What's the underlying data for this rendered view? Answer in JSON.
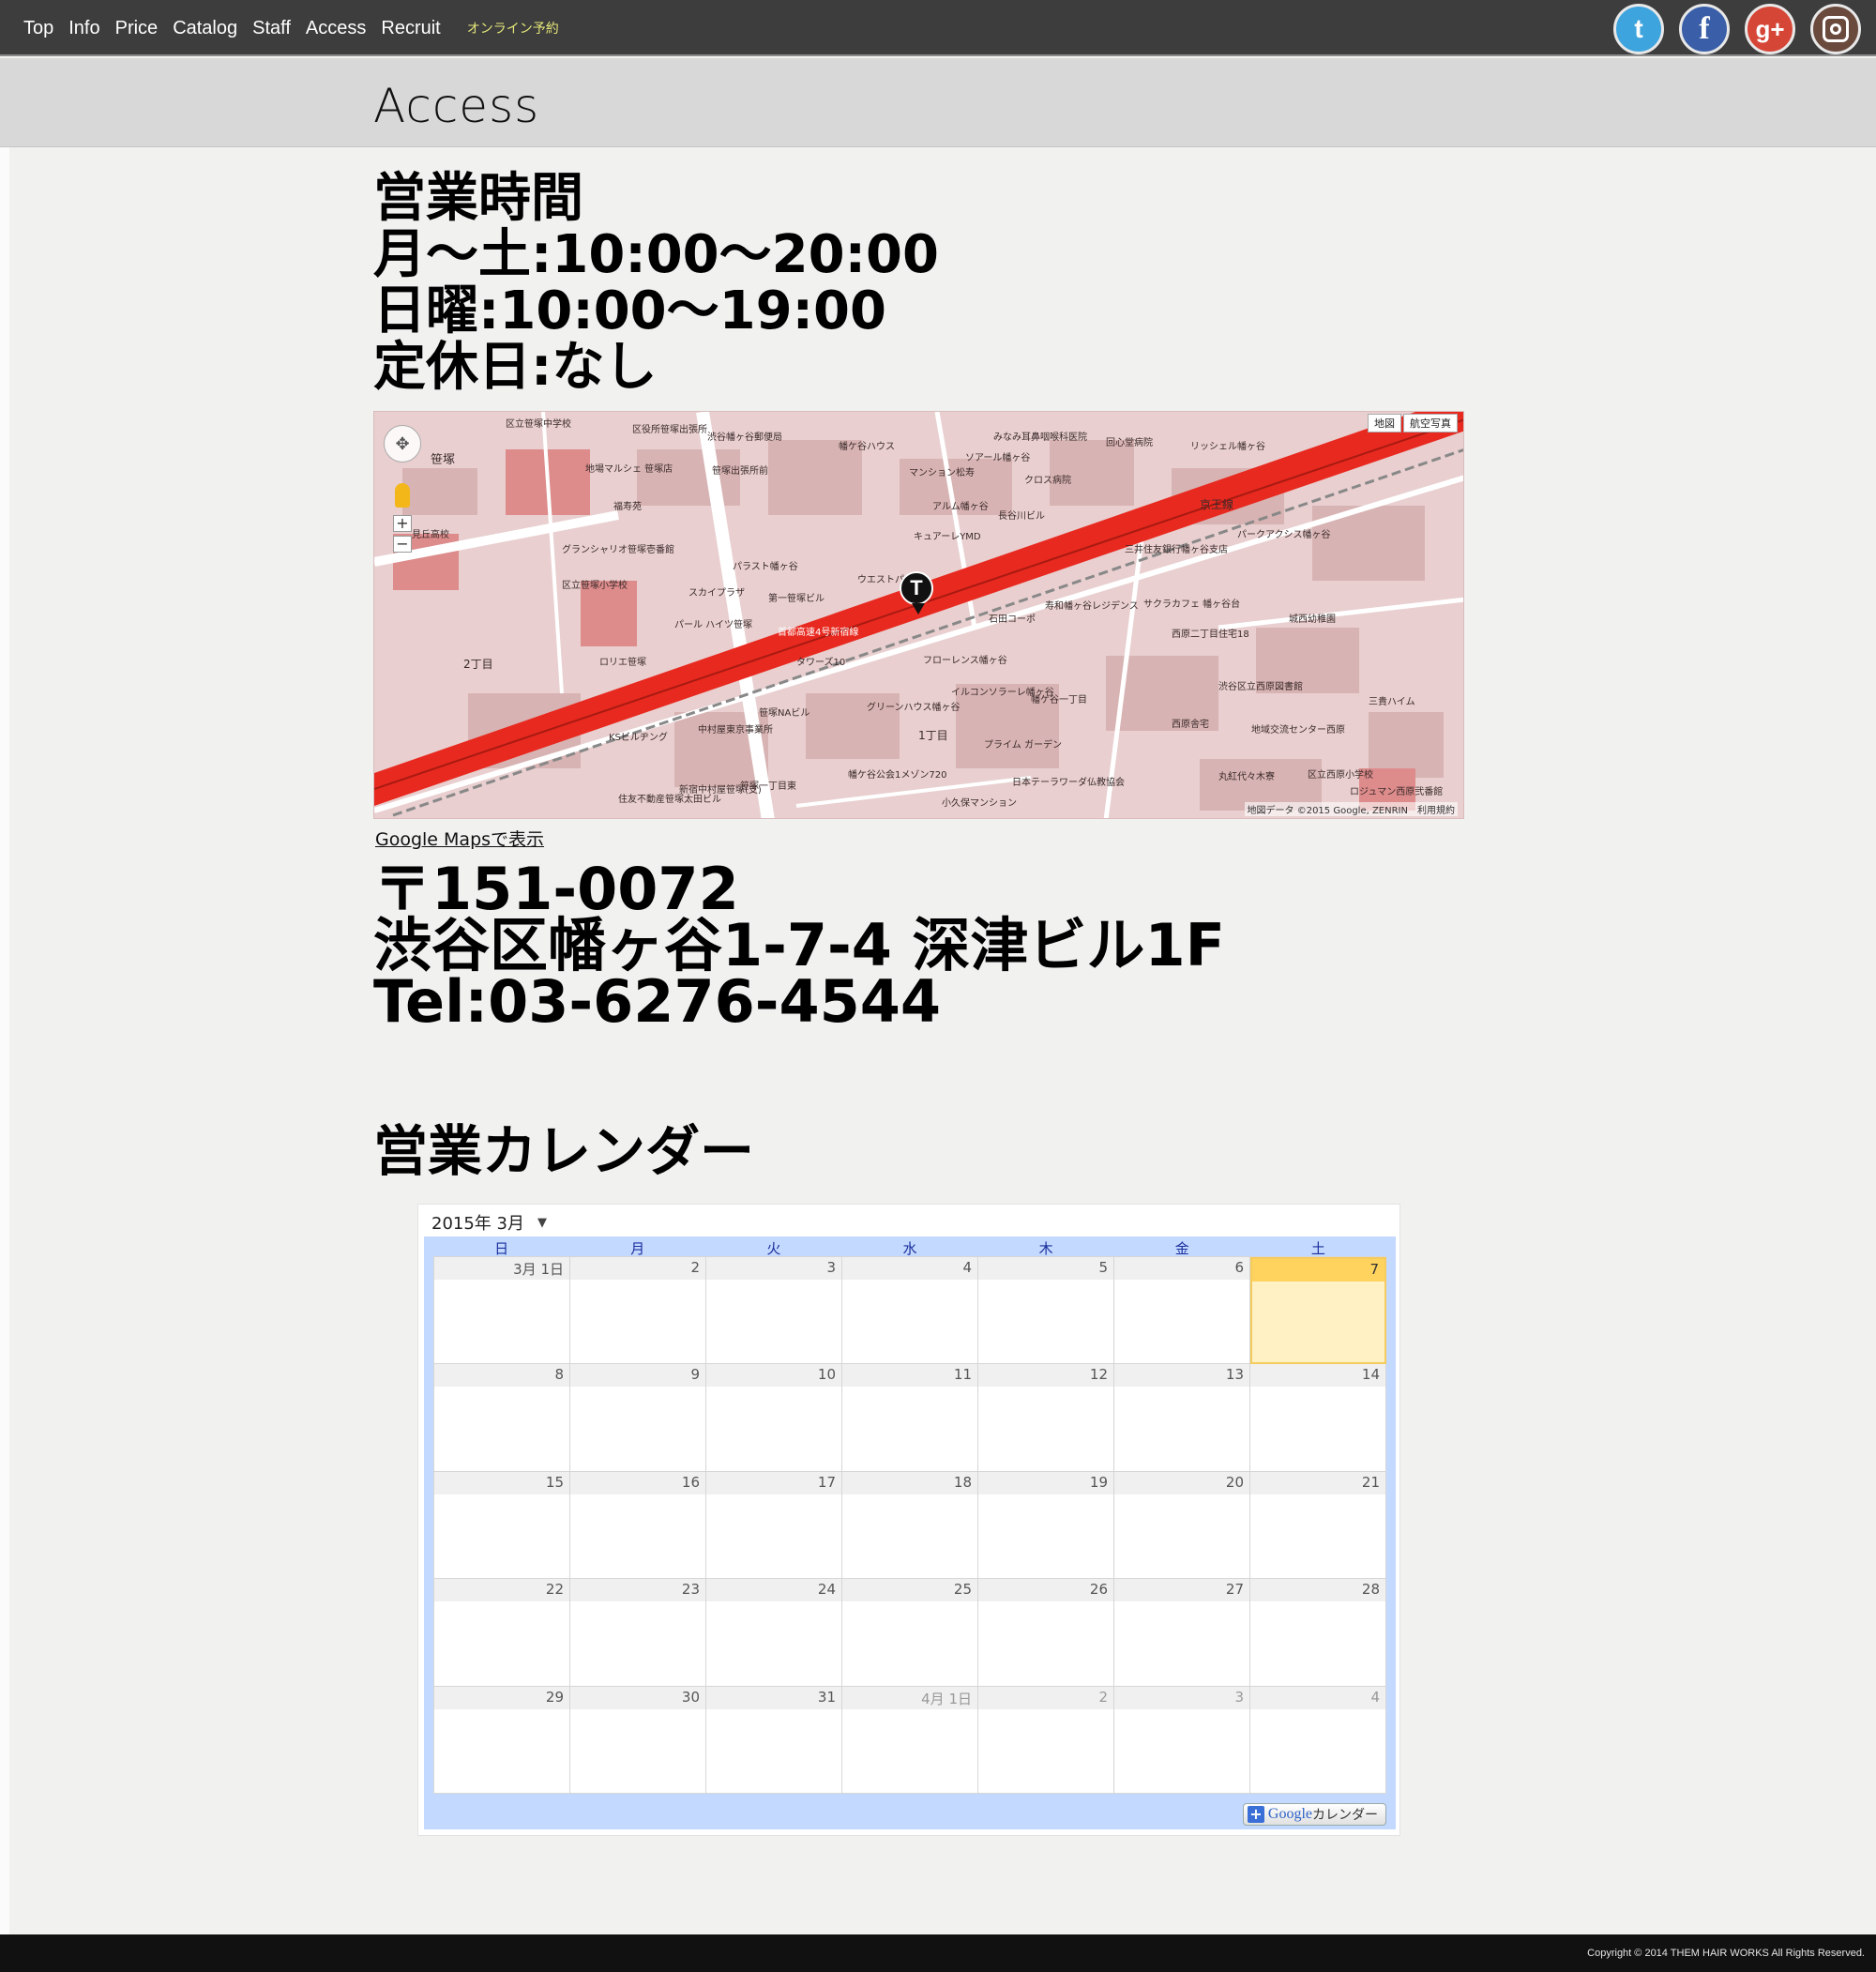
{
  "nav": {
    "items": [
      "Top",
      "Info",
      "Price",
      "Catalog",
      "Staff",
      "Access",
      "Recruit"
    ],
    "booking_label": "オンライン予約"
  },
  "social": {
    "twitter_glyph": "t",
    "facebook_glyph": "f",
    "googleplus_glyph": "g+",
    "icons": [
      "twitter-icon",
      "facebook-icon",
      "googleplus-icon",
      "instagram-icon"
    ]
  },
  "page": {
    "title": "Access"
  },
  "hours": {
    "heading": "営業時間",
    "weekday": "月〜土:10:00〜20:00",
    "sunday": "日曜:10:00〜19:00",
    "closed": "定休日:なし"
  },
  "map": {
    "link_label": "Google Mapsで表示",
    "type_map": "地図",
    "type_satellite": "航空写真",
    "attribution": "地図データ ©2015 Google, ZENRIN　利用規約",
    "marker_label": "T",
    "labels": [
      "区立笹塚中学校",
      "区役所笹塚出張所",
      "渋谷幡ヶ谷郵便局",
      "幡ケ谷ハウス",
      "みなみ耳鼻咽喉科医院",
      "回心堂病院",
      "笹塚",
      "地場マルシェ 笹塚店",
      "笹塚出張所前",
      "ソアール幡ヶ谷",
      "マンション松寿",
      "クロス病院",
      "リッシェル幡ヶ谷",
      "京王線",
      "福寿苑",
      "アルム幡ヶ谷",
      "長谷川ビル",
      "パークアクシス幡ヶ谷",
      "見丘高校",
      "グランシャリオ笹塚壱番館",
      "パラスト幡ヶ谷",
      "キュアーレYMD",
      "三井住友銀行幡ヶ谷支店",
      "区立笹塚小学校",
      "スカイプラザ",
      "第一笹塚ビル",
      "ウエストパーク",
      "サクラカフェ 幡ヶ谷台",
      "首都高速4号新宿線",
      "石田コーポ",
      "寿和幡ヶ谷レジデンス",
      "西原二丁目住宅18",
      "パール ハイツ笹塚",
      "タワーズ10",
      "フローレンス幡ヶ谷",
      "城西幼稚園",
      "ロリエ笹塚",
      "イルコンソラーレ幡ヶ谷",
      "幡ケ谷一丁目",
      "渋谷区立西原図書館",
      "三貴ハイム",
      "グリーンハウス幡ヶ谷",
      "西原舎宅",
      "KSビルヂング",
      "笹塚NAビル",
      "プライム ガーデン",
      "地域交流センター西原",
      "中村屋東京事業所",
      "日本テーラワーダ仏教協会",
      "丸紅代々木寮",
      "区立西原小学校",
      "住友不動産笹塚太田ビル",
      "新宿中村屋笹塚(支)",
      "笹塚一丁目東",
      "幡ケ谷公会1メゾン720",
      "小久保マンション",
      "ロジュマン西原弐番館",
      "1丁目",
      "2丁目"
    ]
  },
  "address": {
    "postal": "〒151-0072",
    "street": "渋谷区幡ヶ谷1-7-4 深津ビル1F",
    "tel": "Tel:03-6276-4544"
  },
  "calendar": {
    "heading": "営業カレンダー",
    "month_label": "2015年 3月",
    "weekdays": [
      "日",
      "月",
      "火",
      "水",
      "木",
      "金",
      "土"
    ],
    "weeks": [
      [
        "3月 1日",
        "2",
        "3",
        "4",
        "5",
        "6",
        "7"
      ],
      [
        "8",
        "9",
        "10",
        "11",
        "12",
        "13",
        "14"
      ],
      [
        "15",
        "16",
        "17",
        "18",
        "19",
        "20",
        "21"
      ],
      [
        "22",
        "23",
        "24",
        "25",
        "26",
        "27",
        "28"
      ],
      [
        "29",
        "30",
        "31",
        "4月 1日",
        "2",
        "3",
        "4"
      ]
    ],
    "today": "7",
    "badge_g": "Google",
    "badge_text": "カレンダー"
  },
  "footer": {
    "copyright": "Copyright © 2014  THEM HAIR WORKS All Rights Reserved."
  }
}
